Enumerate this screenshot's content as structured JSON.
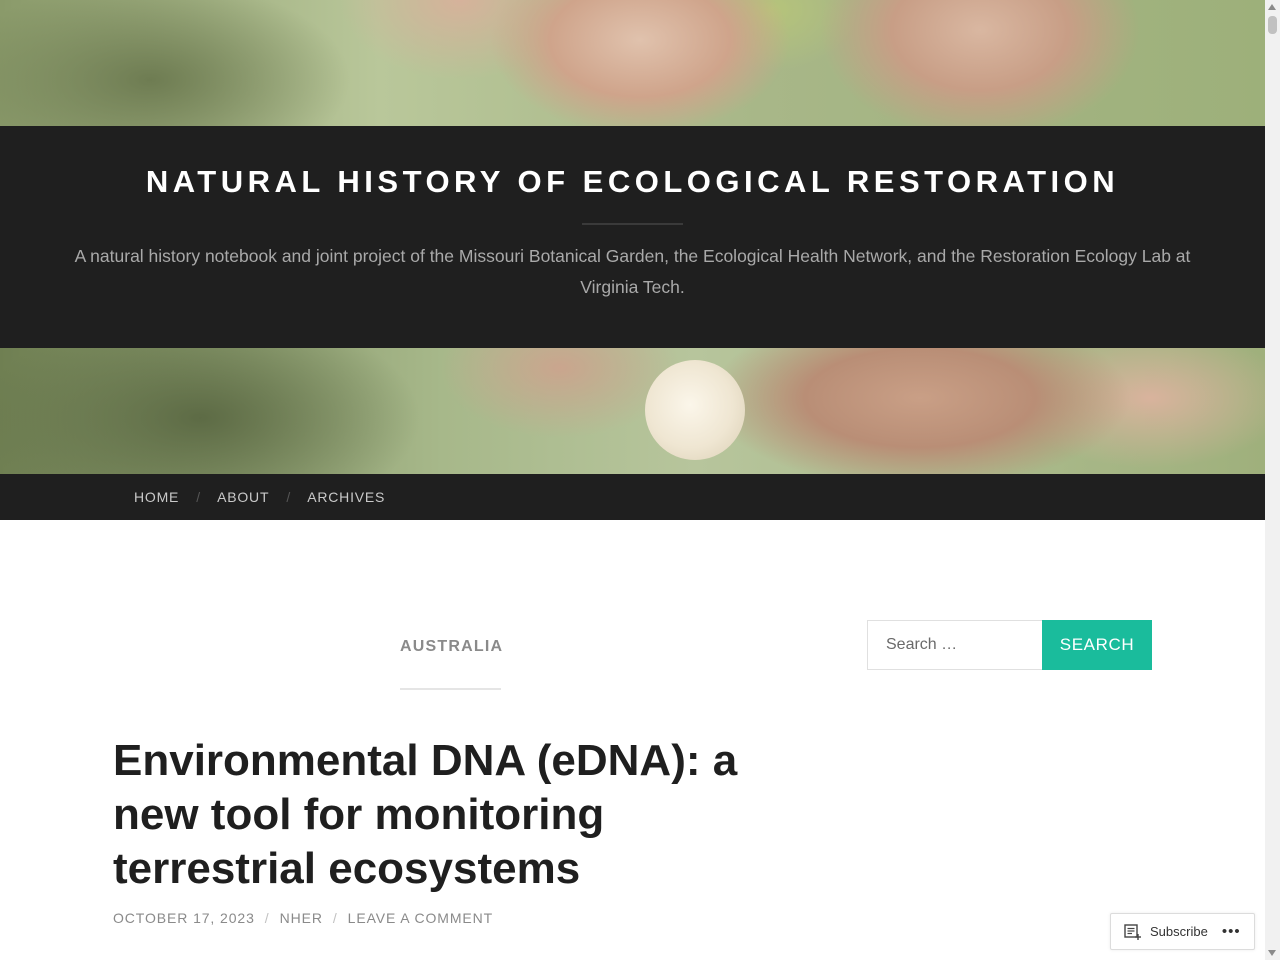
{
  "site": {
    "title": "NATURAL HISTORY OF ECOLOGICAL RESTORATION",
    "tagline": "A natural history notebook and joint project of the Missouri Botanical Garden, the Ecological Health Network, and the Restoration Ecology Lab at Virginia Tech."
  },
  "nav": {
    "items": [
      {
        "label": "HOME"
      },
      {
        "label": "ABOUT"
      },
      {
        "label": "ARCHIVES"
      }
    ],
    "separator": "/"
  },
  "category": {
    "label": "AUSTRALIA"
  },
  "post": {
    "title": "Environmental DNA (eDNA): a new tool for monitoring terrestrial ecosystems",
    "date": "OCTOBER 17, 2023",
    "author": "NHER",
    "comment_link": "LEAVE A COMMENT",
    "separator": "/"
  },
  "search": {
    "placeholder": "Search …",
    "button_label": "SEARCH"
  },
  "subscribe": {
    "label": "Subscribe",
    "more": "•••"
  },
  "colors": {
    "header_bg": "#1f1f1f",
    "accent": "#1abc9c"
  },
  "icons": {
    "subscribe": "reader-icon",
    "more": "ellipsis-icon"
  }
}
